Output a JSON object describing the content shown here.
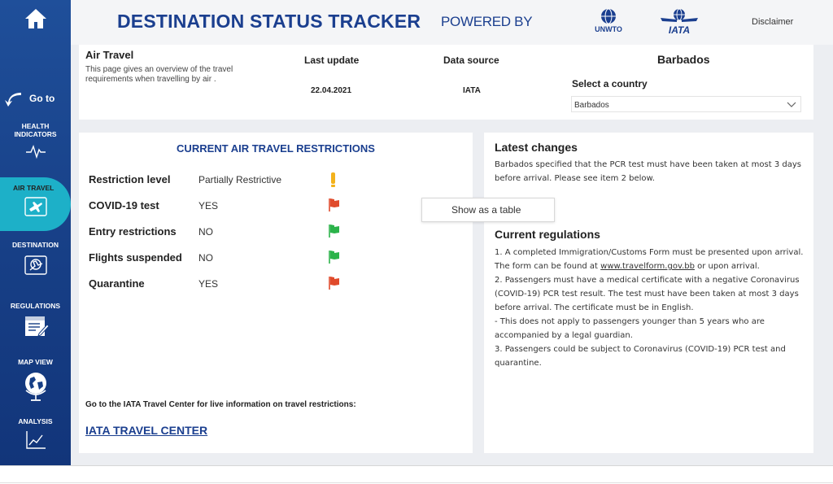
{
  "colors": {
    "brand": "#1b3f8f",
    "sidebar": "#173f86",
    "active": "#1db0c8",
    "flag_red": "#e04a2b",
    "flag_green": "#2bb34a",
    "flag_amber": "#f3b21c"
  },
  "sidebar": {
    "home_icon": "home-icon",
    "goto_label": "Go to",
    "items": [
      {
        "label": "HEALTH INDICATORS",
        "icon": "heartbeat-icon",
        "active": false
      },
      {
        "label": "AIR TRAVEL",
        "icon": "air-travel-icon",
        "active": true
      },
      {
        "label": "DESTINATION",
        "icon": "destination-icon",
        "active": false
      },
      {
        "label": "REGULATIONS",
        "icon": "regulations-icon",
        "active": false
      },
      {
        "label": "MAP VIEW",
        "icon": "globe-icon",
        "active": false
      },
      {
        "label": "ANALYSIS",
        "icon": "chart-icon",
        "active": false
      }
    ]
  },
  "header": {
    "title": "DESTINATION STATUS TRACKER",
    "powered_by": "POWERED BY",
    "logo1": "UNWTO",
    "logo2": "IATA",
    "disclaimer": "Disclaimer"
  },
  "info": {
    "title": "Air Travel",
    "description": "This page gives an overview of the travel requirements when travelling by air .",
    "last_update_label": "Last update",
    "last_update_value": "22.04.2021",
    "data_source_label": "Data source",
    "data_source_value": "IATA",
    "country_heading": "Barbados",
    "select_label": "Select a country",
    "selected_country": "Barbados"
  },
  "restrictions": {
    "title": "CURRENT AIR TRAVEL RESTRICTIONS",
    "rows": [
      {
        "name": "Restriction level",
        "value": "Partially Restrictive",
        "status": "amber"
      },
      {
        "name": "COVID-19 test",
        "value": "YES",
        "status": "red"
      },
      {
        "name": "Entry restrictions",
        "value": "NO",
        "status": "green"
      },
      {
        "name": "Flights suspended",
        "value": "NO",
        "status": "green"
      },
      {
        "name": "Quarantine",
        "value": "YES",
        "status": "red"
      }
    ],
    "footer_text": "Go to the IATA Travel Center for live information on travel restrictions:",
    "link_text": "IATA TRAVEL CENTER"
  },
  "tooltip": {
    "label": "Show as a table"
  },
  "changes": {
    "latest_heading": "Latest changes",
    "latest_text": "Barbados specified that the PCR test must have been taken at most 3 days before arrival. Please see item 2 below.",
    "regs_heading": "Current regulations",
    "regs_p1_before": "1. A completed Immigration/Customs Form must be presented upon arrival. The form can be found at ",
    "regs_p1_link": "www.travelform.gov.bb",
    "regs_p1_after": " or upon arrival.",
    "regs_p2": "2. Passengers must have a medical certificate with a negative Coronavirus (COVID-19) PCR test result. The test must have been taken at most 3 days before arrival. The certificate must be in English.",
    "regs_p3": "- This does not apply to passengers younger than 5 years who are accompanied by a legal guardian.",
    "regs_p4": "3. Passengers could be subject to Coronavirus (COVID-19) PCR test and quarantine."
  }
}
